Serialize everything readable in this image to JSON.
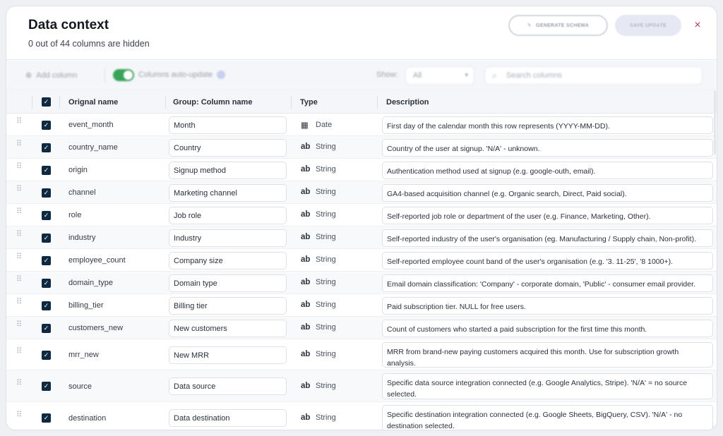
{
  "header": {
    "title": "Data context",
    "subtitle": "0 out of 44 columns are hidden",
    "generate_label": "GENERATE SCHEMA",
    "save_label": "SAVE UPDATE",
    "close_glyph": "×"
  },
  "toolbar": {
    "add_label": "Add column",
    "auto_update_label": "Columns auto-update",
    "show_label": "Show:",
    "show_value": "All",
    "search_placeholder": "Search columns"
  },
  "table": {
    "headers": {
      "original": "Orignal name",
      "group": "Group: Column name",
      "type": "Type",
      "description": "Description"
    },
    "rows": [
      {
        "original": "event_month",
        "name": "Month",
        "type_icon": "calendar-icon",
        "type": "Date",
        "description": "First day of the calendar month this row represents (YYYY-MM-DD)."
      },
      {
        "original": "country_name",
        "name": "Country",
        "type_icon": "string-icon",
        "type": "String",
        "description": "Country of the user at signup. 'N/A' - unknown."
      },
      {
        "original": "origin",
        "name": "Signup method",
        "type_icon": "string-icon",
        "type": "String",
        "description": "Authentication method used at signup (e.g. google-outh, email)."
      },
      {
        "original": "channel",
        "name": "Marketing channel",
        "type_icon": "string-icon",
        "type": "String",
        "description": "GA4-based acquisition channel (e.g. Organic search, Direct, Paid social)."
      },
      {
        "original": "role",
        "name": "Job role",
        "type_icon": "string-icon",
        "type": "String",
        "description": "Self-reported job role or department of the user (e.g. Finance, Marketing, Other)."
      },
      {
        "original": "industry",
        "name": "Industry",
        "type_icon": "string-icon",
        "type": "String",
        "description": "Self-reported industry of the user's organisation (eg. Manufacturing / Supply chain, Non-profit)."
      },
      {
        "original": "employee_count",
        "name": "Company size",
        "type_icon": "string-icon",
        "type": "String",
        "description": "Self-reported employee count band of the user's organisation (e.g. '3. 11-25', '8 1000+)."
      },
      {
        "original": "domain_type",
        "name": "Domain type",
        "type_icon": "string-icon",
        "type": "String",
        "description": "Email domain classification: 'Company' - corporate domain, 'Public' - consumer email provider."
      },
      {
        "original": "billing_tier",
        "name": "Billing tier",
        "type_icon": "string-icon",
        "type": "String",
        "description": "Paid subscription tier. NULL for free users."
      },
      {
        "original": "customers_new",
        "name": "New customers",
        "type_icon": "string-icon",
        "type": "String",
        "description": "Count of customers who started a paid subscription for the first time this month."
      },
      {
        "original": "mrr_new",
        "name": "New MRR",
        "type_icon": "string-icon",
        "type": "String",
        "description": "MRR from brand-new paying customers acquired this month. Use for subscription growth analysis."
      },
      {
        "original": "source",
        "name": "Data source",
        "type_icon": "string-icon",
        "type": "String",
        "description": "Specific data source integration connected (e.g. Google Analytics, Stripe). 'N/A' = no source selected."
      },
      {
        "original": "destination",
        "name": "Data destination",
        "type_icon": "string-icon",
        "type": "String",
        "description": "Specific destination integration connected (e.g. Google Sheets, BigQuery, CSV). 'N/A' - no destination selected."
      }
    ]
  },
  "colors": {
    "checkbox": "#0f2a40",
    "toggle_on": "#3aa35a",
    "close": "#b03a4e"
  }
}
